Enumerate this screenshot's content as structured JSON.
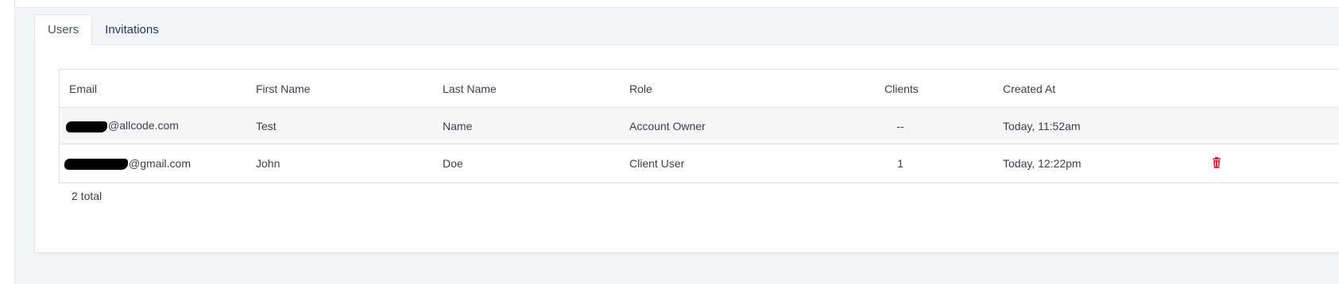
{
  "tabs": [
    {
      "label": "Users",
      "active": true
    },
    {
      "label": "Invitations",
      "active": false
    }
  ],
  "table": {
    "columns": {
      "email": "Email",
      "first_name": "First Name",
      "last_name": "Last Name",
      "role": "Role",
      "clients": "Clients",
      "created_at": "Created At"
    },
    "rows": [
      {
        "email_domain": "@allcode.com",
        "first_name": "Test",
        "last_name": "Name",
        "role": "Account Owner",
        "clients": "--",
        "created_at": "Today, 11:52am",
        "delete_icon": null
      },
      {
        "email_domain": "@gmail.com",
        "first_name": "John",
        "last_name": "Doe",
        "role": "Client User",
        "clients": "1",
        "created_at": "Today, 12:22pm",
        "delete_icon": "trash-icon"
      }
    ]
  },
  "footer": {
    "total": "2 total"
  },
  "colors": {
    "tab_text": "#1f3a60",
    "delete": "#d9262e",
    "redaction": "#000000"
  }
}
